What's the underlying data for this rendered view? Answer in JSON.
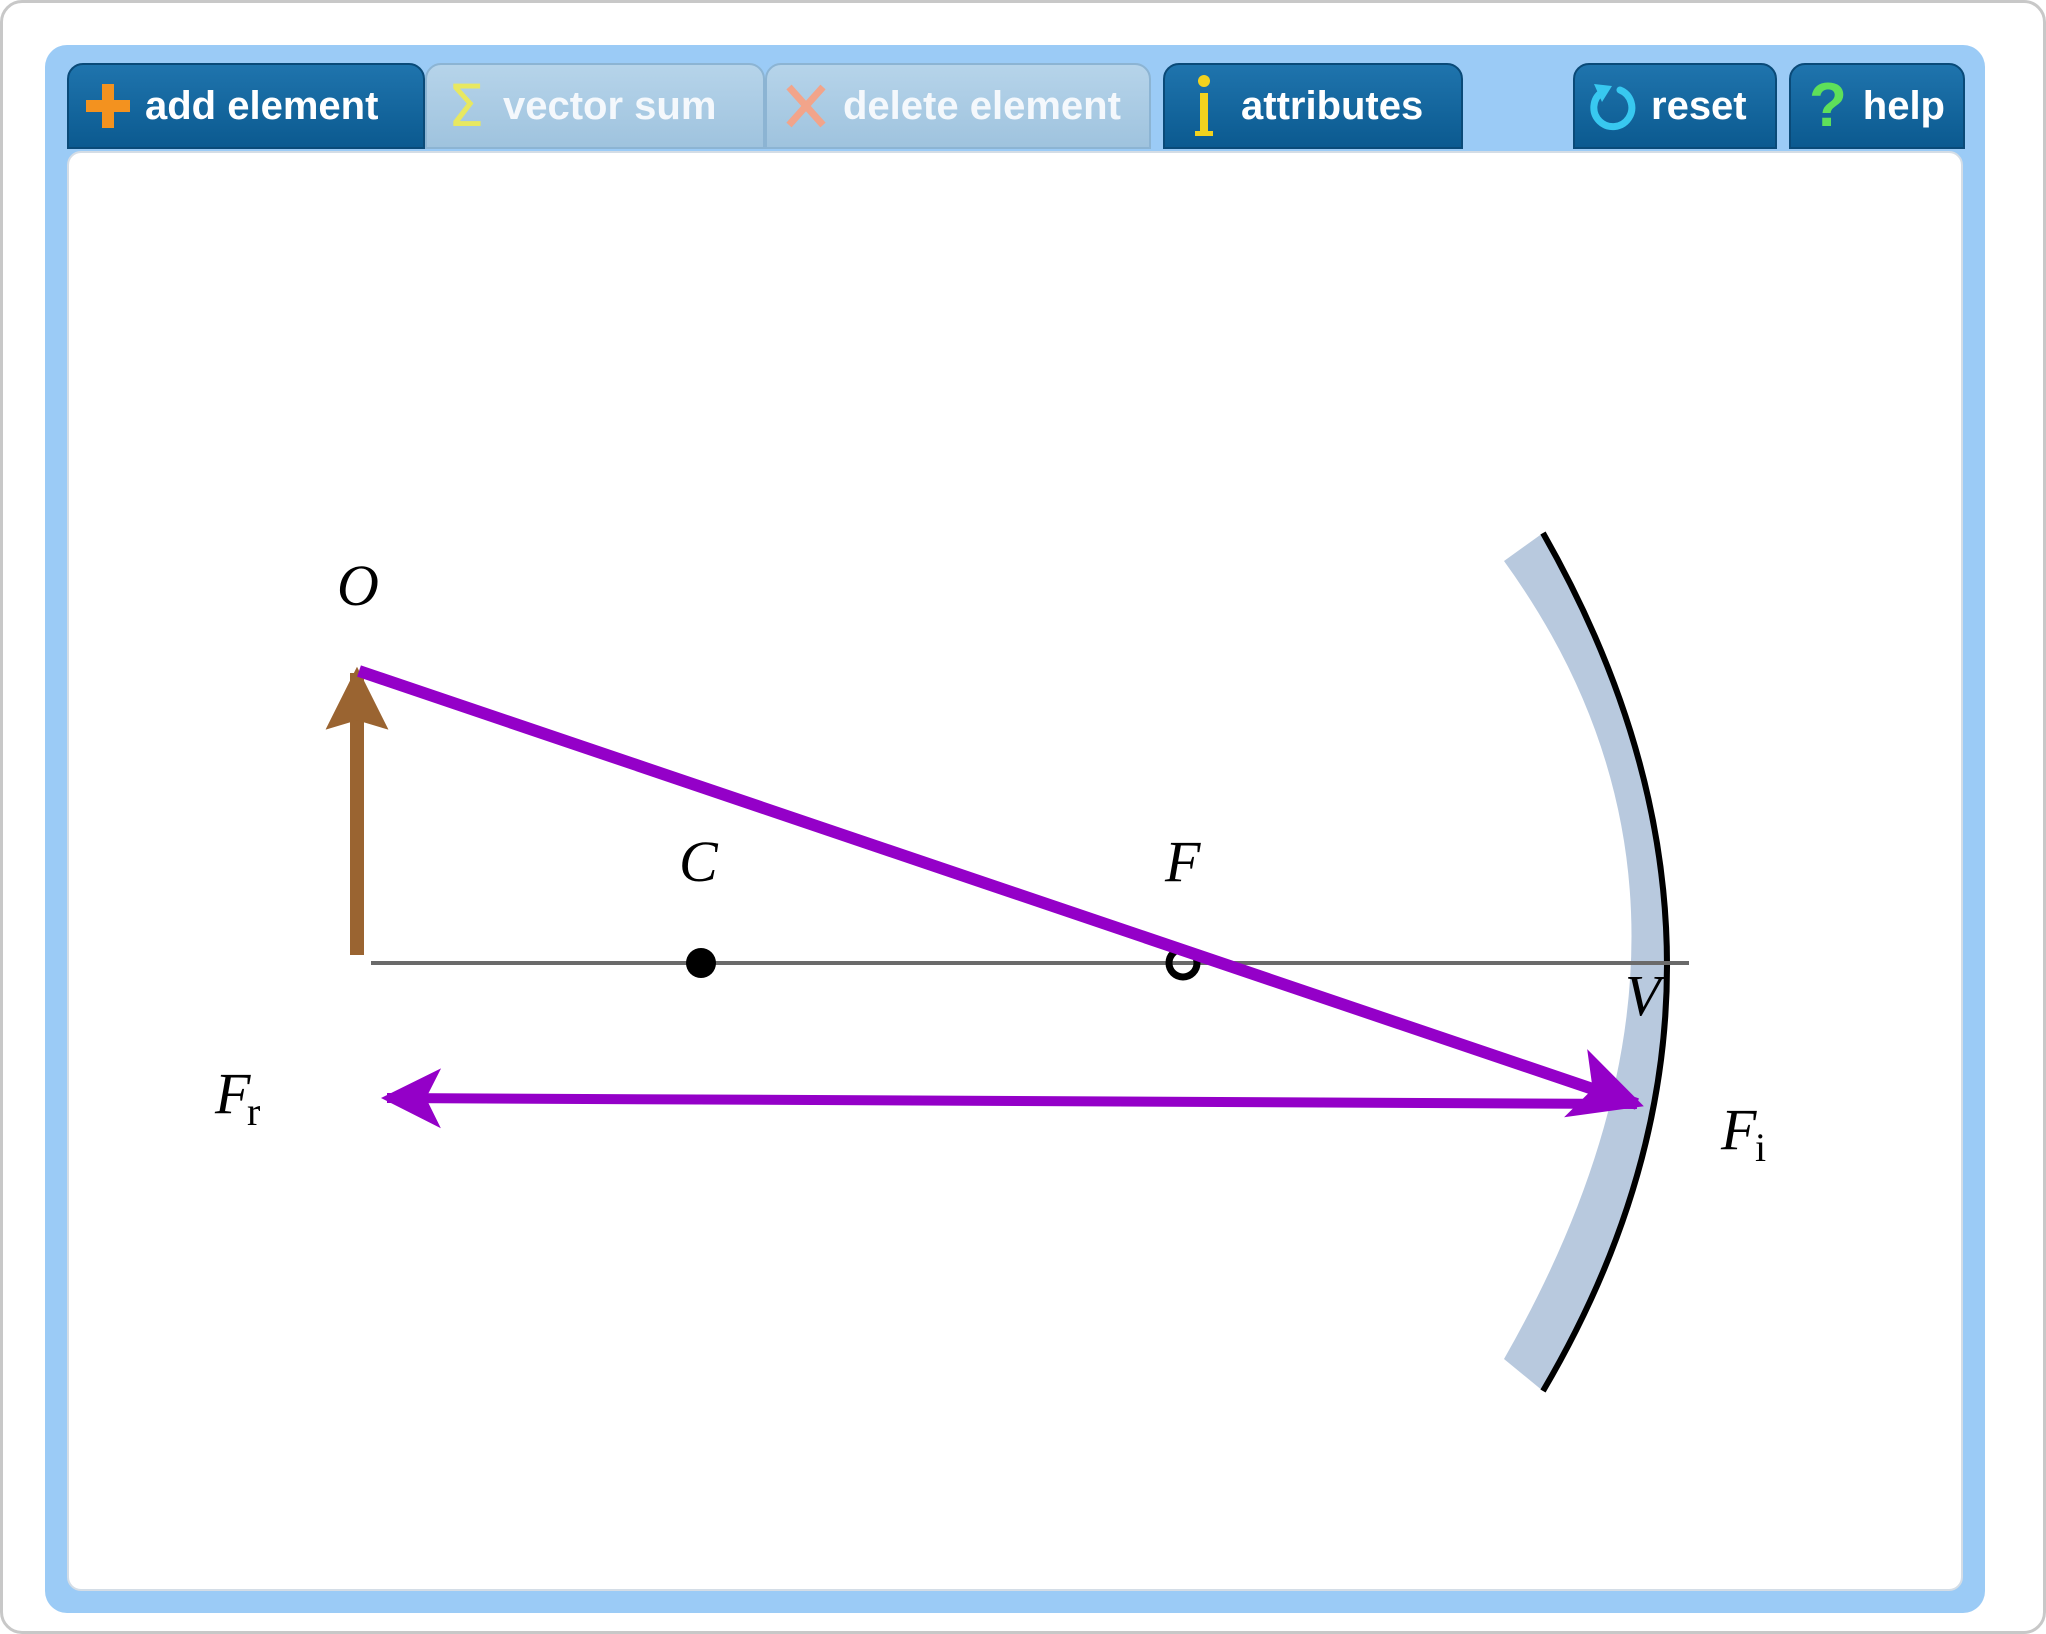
{
  "toolbar": {
    "add_element": {
      "label": "add element",
      "icon": "plus-icon",
      "color": "#f3921f",
      "state": "enabled"
    },
    "vector_sum": {
      "label": "vector sum",
      "icon": "sigma-icon",
      "color": "#e8e860",
      "state": "disabled"
    },
    "delete_element": {
      "label": "delete element",
      "icon": "x-icon",
      "color": "#f2a48a",
      "state": "disabled"
    },
    "attributes": {
      "label": "attributes",
      "icon": "info-icon",
      "color": "#f2d21e",
      "state": "enabled"
    },
    "reset": {
      "label": "reset",
      "icon": "reset-icon",
      "color": "#38c8f0",
      "state": "enabled"
    },
    "help": {
      "label": "help",
      "icon": "question-icon",
      "color": "#5ee05a",
      "state": "enabled"
    }
  },
  "diagram": {
    "labels": {
      "object": "O",
      "center": "C",
      "focal_point": "F",
      "vertex": "V",
      "incident_force": "F",
      "incident_subscript": "i",
      "reflected_force": "F",
      "reflected_subscript": "r"
    },
    "colors": {
      "ray": "#9400c8",
      "object_arrow": "#9a6431",
      "mirror_body": "#b8c9de",
      "mirror_surface": "#000000",
      "axis": "#6a6a6a",
      "points": "#000000"
    }
  }
}
